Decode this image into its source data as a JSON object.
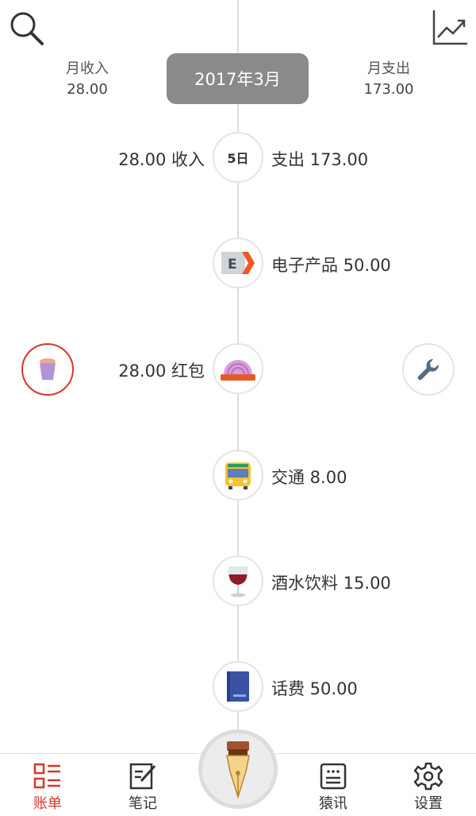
{
  "header": {
    "search_icon": "search-icon",
    "chart_icon": "trend-chart-icon",
    "month_label": "2017年3月",
    "income": {
      "label": "月收入",
      "amount": "28.00"
    },
    "expense": {
      "label": "月支出",
      "amount": "173.00"
    }
  },
  "day_group": {
    "day": "5日",
    "income_text": "28.00 收入",
    "expense_text": "支出 173.00"
  },
  "entries": [
    {
      "icon": "electronics-icon",
      "side": "right",
      "text": "电子产品 50.00"
    },
    {
      "icon": "red-packet-icon",
      "side": "left",
      "text": "28.00 红包"
    },
    {
      "icon": "bus-icon",
      "side": "right",
      "text": "交通 8.00"
    },
    {
      "icon": "wine-glass-icon",
      "side": "right",
      "text": "酒水饮料 15.00"
    },
    {
      "icon": "book-icon",
      "side": "right",
      "text": "话费 50.00"
    }
  ],
  "actions": {
    "delete_icon": "trash-icon",
    "edit_icon": "wrench-icon"
  },
  "bottom_nav": {
    "items": [
      {
        "label": "账单",
        "icon": "bill-list-icon",
        "active": true
      },
      {
        "label": "笔记",
        "icon": "note-edit-icon",
        "active": false
      },
      {
        "label": "猿讯",
        "icon": "news-icon",
        "active": false
      },
      {
        "label": "设置",
        "icon": "gear-icon",
        "active": false
      }
    ],
    "center_icon": "fountain-pen-icon"
  },
  "colors": {
    "accent": "#d9362b",
    "pill": "#8a8a8a",
    "timeline": "#dedede"
  }
}
